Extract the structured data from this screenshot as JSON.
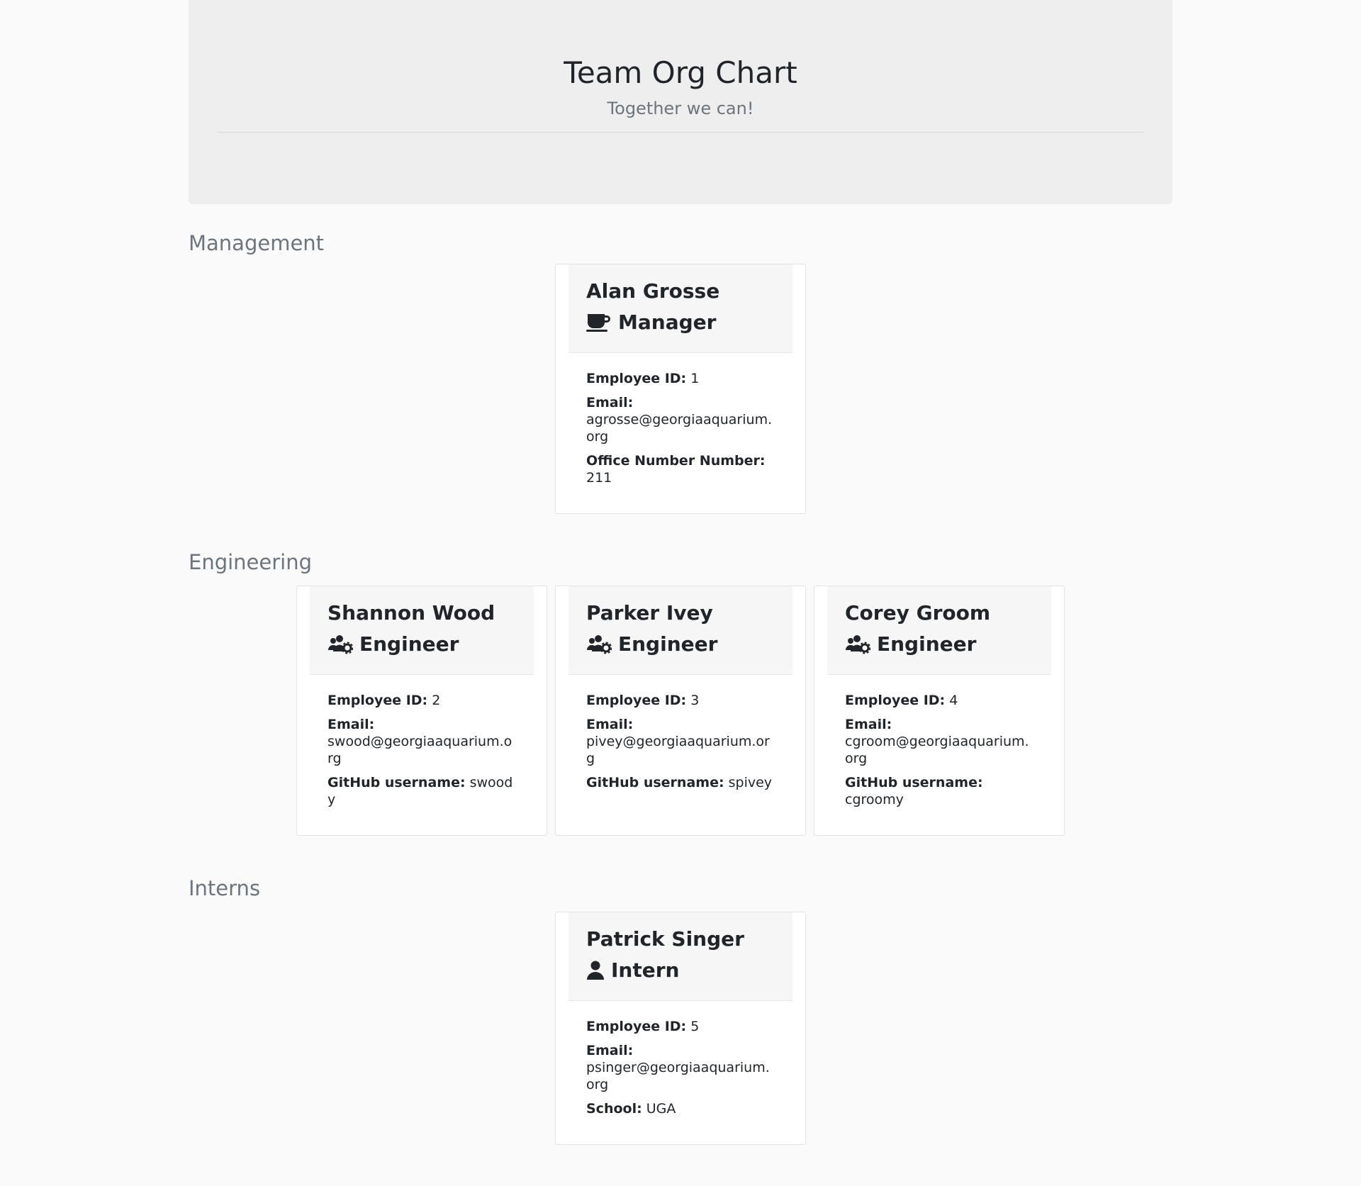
{
  "header": {
    "title": "Team Org Chart",
    "subtitle": "Together we can!"
  },
  "sections": {
    "management": {
      "title": "Management",
      "cards": [
        {
          "name": "Alan Grosse",
          "role": "Manager",
          "icon": "coffee-icon",
          "id_label": "Employee ID:",
          "id": "1",
          "email_label": "Email:",
          "email": "agrosse@georgiaaquarium.org",
          "extra_label": "Office Number Number:",
          "extra": "211"
        }
      ]
    },
    "engineering": {
      "title": "Engineering",
      "cards": [
        {
          "name": "Shannon Wood",
          "role": "Engineer",
          "icon": "users-cog-icon",
          "id_label": "Employee ID:",
          "id": "2",
          "email_label": "Email:",
          "email": "swood@georgiaaquarium.org",
          "extra_label": "GitHub username:",
          "extra": "swoody"
        },
        {
          "name": "Parker Ivey",
          "role": "Engineer",
          "icon": "users-cog-icon",
          "id_label": "Employee ID:",
          "id": "3",
          "email_label": "Email:",
          "email": "pivey@georgiaaquarium.org",
          "extra_label": "GitHub username:",
          "extra": "spivey"
        },
        {
          "name": "Corey Groom",
          "role": "Engineer",
          "icon": "users-cog-icon",
          "id_label": "Employee ID:",
          "id": "4",
          "email_label": "Email:",
          "email": "cgroom@georgiaaquarium.org",
          "extra_label": "GitHub username:",
          "extra": "cgroomy"
        }
      ]
    },
    "interns": {
      "title": "Interns",
      "cards": [
        {
          "name": "Patrick Singer",
          "role": "Intern",
          "icon": "user-icon",
          "id_label": "Employee ID:",
          "id": "5",
          "email_label": "Email:",
          "email": "psinger@georgiaaquarium.org",
          "extra_label": "School:",
          "extra": "UGA"
        }
      ]
    }
  },
  "colors": {
    "page_background": "#fafafa",
    "jumbotron_background": "#eeeeee",
    "card_header_background": "#f6f6f6",
    "muted_text": "#6c757d",
    "text": "#212529"
  }
}
